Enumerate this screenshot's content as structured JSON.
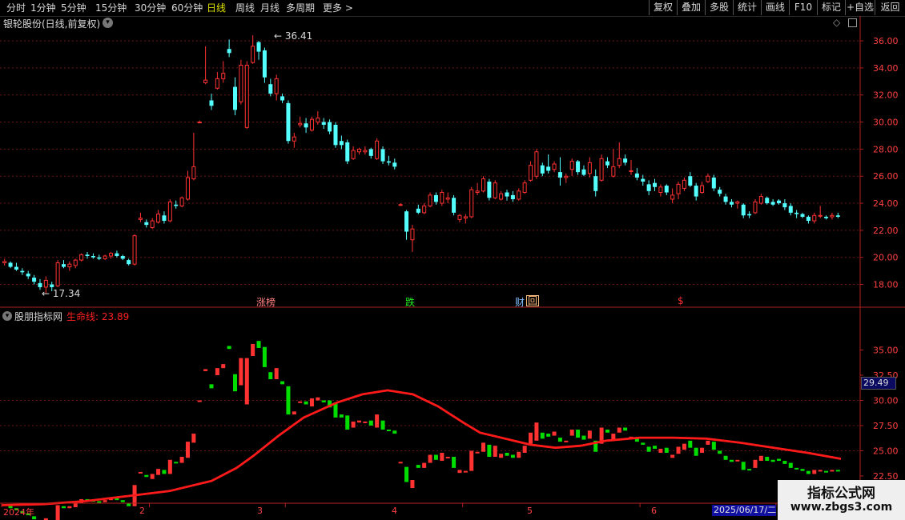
{
  "toolbar": {
    "periods": [
      {
        "label": "分时",
        "active": false
      },
      {
        "label": "1分钟",
        "active": false
      },
      {
        "label": "5分钟",
        "active": false
      },
      {
        "label": "15分钟",
        "active": false
      },
      {
        "label": "30分钟",
        "active": false
      },
      {
        "label": "60分钟",
        "active": false
      },
      {
        "label": "日线",
        "active": true
      },
      {
        "label": "周线",
        "active": false
      },
      {
        "label": "月线",
        "active": false
      },
      {
        "label": "多周期",
        "active": false
      },
      {
        "label": "更多 >",
        "active": false
      }
    ],
    "actions": [
      "复权",
      "叠加",
      "多股",
      "统计",
      "画线",
      "F10",
      "标记",
      "+自选",
      "返回"
    ]
  },
  "main_panel": {
    "title": "银轮股份(日线,前复权)",
    "high_label": "36.41",
    "low_label": "17.34",
    "event_markers": [
      "涨榜",
      "跌",
      "财",
      "回",
      "$"
    ]
  },
  "indicator_panel": {
    "name": "股朋指标网",
    "line_label": "生命线: 23.89",
    "current_value_tag": "29.49"
  },
  "time_axis": {
    "labels": [
      "2024年",
      "2",
      "3",
      "4",
      "5",
      "6"
    ],
    "cursor_date": "2025/06/17/二"
  },
  "watermark": {
    "title": "指标公式网",
    "url": "www.zbgs3.com"
  },
  "colors": {
    "up": "#ff3232",
    "down": "#54ffff",
    "indicator_down": "#00dd00",
    "life_line": "#ff1a1a",
    "axis": "#b02020",
    "grid": "#6a1515"
  },
  "chart_data": [
    {
      "type": "candlestick",
      "title": "银轮股份(日线,前复权)",
      "y_axis_ticks": [
        18.0,
        20.0,
        22.0,
        24.0,
        26.0,
        28.0,
        30.0,
        32.0,
        34.0,
        36.0
      ],
      "ylim": [
        16.2,
        37.6
      ],
      "x_labels": [
        "2024年",
        "2",
        "3",
        "4",
        "5",
        "6"
      ],
      "annotations": {
        "high": 36.41,
        "low": 17.34
      },
      "ohlc": [
        [
          19.6,
          19.9,
          19.4,
          19.7
        ],
        [
          19.6,
          19.7,
          19.2,
          19.3
        ],
        [
          19.3,
          19.6,
          19.0,
          19.1
        ],
        [
          19.0,
          19.2,
          18.7,
          18.9
        ],
        [
          18.8,
          19.0,
          18.4,
          18.6
        ],
        [
          18.5,
          18.7,
          18.0,
          18.2
        ],
        [
          18.1,
          18.4,
          17.6,
          17.8
        ],
        [
          17.8,
          18.6,
          17.34,
          18.3
        ],
        [
          18.0,
          18.2,
          17.5,
          17.8
        ],
        [
          17.9,
          19.8,
          17.8,
          19.6
        ],
        [
          19.5,
          19.8,
          19.2,
          19.3
        ],
        [
          19.3,
          19.7,
          19.0,
          19.5
        ],
        [
          19.4,
          19.9,
          19.2,
          19.8
        ],
        [
          19.8,
          20.3,
          19.7,
          20.2
        ],
        [
          20.2,
          20.4,
          19.9,
          20.1
        ],
        [
          20.1,
          20.3,
          19.9,
          20.0
        ],
        [
          20.0,
          20.2,
          19.8,
          19.9
        ],
        [
          19.9,
          20.2,
          19.8,
          20.1
        ],
        [
          20.1,
          20.4,
          19.9,
          20.3
        ],
        [
          20.3,
          20.5,
          20.0,
          20.1
        ],
        [
          20.1,
          20.2,
          19.8,
          19.9
        ],
        [
          19.8,
          19.9,
          19.4,
          19.5
        ],
        [
          19.5,
          21.7,
          19.4,
          21.6
        ],
        [
          22.8,
          23.3,
          22.6,
          22.9
        ],
        [
          22.6,
          22.8,
          22.2,
          22.4
        ],
        [
          22.2,
          22.9,
          22.1,
          22.7
        ],
        [
          22.6,
          23.5,
          22.5,
          23.2
        ],
        [
          23.1,
          23.4,
          22.5,
          22.7
        ],
        [
          22.7,
          24.3,
          22.6,
          24.1
        ],
        [
          23.9,
          24.2,
          23.6,
          23.8
        ],
        [
          23.8,
          24.5,
          23.7,
          24.4
        ],
        [
          24.3,
          26.4,
          24.2,
          25.9
        ],
        [
          25.8,
          29.2,
          25.7,
          26.7
        ],
        [
          30.0,
          30.1,
          29.9,
          30.0
        ],
        [
          32.9,
          35.6,
          32.8,
          33.1
        ],
        [
          31.6,
          32.1,
          30.9,
          31.2
        ],
        [
          32.5,
          33.7,
          32.4,
          33.2
        ],
        [
          33.2,
          34.5,
          32.9,
          33.6
        ],
        [
          35.4,
          36.1,
          34.8,
          35.1
        ],
        [
          32.6,
          33.3,
          30.5,
          30.9
        ],
        [
          31.5,
          34.6,
          31.3,
          34.2
        ],
        [
          29.6,
          34.5,
          29.5,
          34.2
        ],
        [
          34.4,
          36.41,
          34.3,
          35.6
        ],
        [
          35.9,
          36.0,
          34.6,
          35.2
        ],
        [
          35.3,
          35.5,
          32.9,
          33.3
        ],
        [
          32.8,
          33.2,
          31.9,
          32.1
        ],
        [
          32.1,
          33.5,
          31.6,
          33.2
        ],
        [
          31.9,
          32.1,
          31.4,
          31.6
        ],
        [
          31.4,
          31.6,
          28.4,
          28.6
        ],
        [
          28.6,
          29.2,
          28.1,
          28.9
        ],
        [
          29.8,
          30.4,
          29.6,
          29.9
        ],
        [
          29.9,
          30.3,
          29.2,
          29.6
        ],
        [
          29.4,
          30.4,
          29.3,
          30.2
        ],
        [
          30.0,
          30.8,
          29.8,
          30.3
        ],
        [
          30.0,
          30.3,
          29.5,
          29.8
        ],
        [
          30.0,
          30.2,
          29.1,
          29.3
        ],
        [
          29.8,
          30.0,
          28.1,
          28.3
        ],
        [
          28.6,
          29.0,
          28.0,
          28.3
        ],
        [
          28.5,
          28.7,
          26.9,
          27.1
        ],
        [
          27.3,
          28.2,
          27.2,
          27.9
        ],
        [
          27.8,
          28.1,
          27.6,
          28.0
        ],
        [
          27.8,
          28.2,
          27.6,
          27.9
        ],
        [
          28.0,
          28.1,
          27.3,
          27.5
        ],
        [
          27.3,
          28.8,
          27.2,
          28.6
        ],
        [
          28.0,
          28.2,
          26.9,
          27.1
        ],
        [
          27.1,
          27.5,
          26.8,
          27.0
        ],
        [
          27.0,
          27.3,
          26.5,
          26.7
        ],
        [
          23.9,
          24.0,
          23.8,
          23.9
        ],
        [
          23.4,
          23.5,
          21.3,
          21.9
        ],
        [
          21.3,
          22.4,
          20.4,
          22.1
        ],
        [
          23.6,
          23.9,
          23.2,
          23.3
        ],
        [
          23.3,
          24.0,
          23.2,
          23.8
        ],
        [
          23.8,
          24.8,
          23.7,
          24.6
        ],
        [
          24.6,
          24.8,
          23.9,
          24.1
        ],
        [
          24.0,
          25.0,
          23.8,
          24.8
        ],
        [
          24.3,
          24.8,
          24.0,
          24.4
        ],
        [
          24.4,
          24.6,
          23.1,
          23.3
        ],
        [
          22.8,
          23.2,
          22.6,
          23.1
        ],
        [
          22.9,
          23.2,
          22.5,
          23.0
        ],
        [
          23.0,
          25.2,
          22.9,
          25.0
        ],
        [
          24.8,
          25.5,
          24.6,
          24.9
        ],
        [
          24.9,
          26.0,
          24.8,
          25.8
        ],
        [
          25.6,
          25.8,
          24.2,
          24.4
        ],
        [
          24.4,
          25.7,
          24.3,
          25.5
        ],
        [
          24.3,
          24.9,
          24.2,
          24.7
        ],
        [
          24.8,
          25.0,
          24.2,
          24.5
        ],
        [
          24.6,
          24.9,
          24.1,
          24.3
        ],
        [
          24.3,
          25.1,
          24.2,
          24.9
        ],
        [
          24.8,
          25.7,
          24.7,
          25.5
        ],
        [
          25.7,
          27.1,
          25.6,
          26.8
        ],
        [
          26.0,
          28.0,
          25.8,
          27.8
        ],
        [
          26.8,
          27.0,
          26.0,
          26.2
        ],
        [
          26.7,
          27.6,
          26.2,
          26.4
        ],
        [
          26.5,
          27.1,
          26.3,
          26.9
        ],
        [
          26.3,
          27.4,
          25.3,
          25.9
        ],
        [
          25.9,
          26.2,
          25.5,
          26.0
        ],
        [
          26.5,
          27.3,
          26.0,
          27.1
        ],
        [
          27.1,
          27.2,
          26.1,
          26.3
        ],
        [
          26.5,
          26.8,
          26.0,
          26.1
        ],
        [
          26.2,
          27.4,
          25.9,
          27.0
        ],
        [
          26.0,
          26.5,
          24.5,
          24.9
        ],
        [
          25.7,
          27.6,
          25.6,
          27.3
        ],
        [
          27.1,
          27.4,
          26.6,
          26.8
        ],
        [
          26.0,
          28.0,
          25.9,
          26.7
        ],
        [
          26.8,
          28.5,
          26.6,
          27.3
        ],
        [
          27.3,
          27.6,
          26.8,
          27.0
        ],
        [
          26.4,
          27.2,
          26.1,
          26.4
        ],
        [
          26.2,
          26.6,
          25.7,
          25.9
        ],
        [
          25.8,
          26.1,
          25.3,
          25.6
        ],
        [
          25.4,
          25.7,
          24.6,
          24.9
        ],
        [
          25.5,
          25.8,
          24.9,
          25.2
        ],
        [
          24.8,
          25.4,
          24.5,
          25.2
        ],
        [
          25.3,
          25.4,
          24.6,
          24.8
        ],
        [
          24.3,
          25.1,
          24.0,
          24.6
        ],
        [
          24.7,
          25.6,
          24.3,
          25.4
        ],
        [
          25.1,
          25.9,
          24.9,
          25.7
        ],
        [
          26.0,
          26.3,
          25.2,
          25.3
        ],
        [
          25.3,
          25.5,
          24.2,
          24.5
        ],
        [
          24.8,
          25.6,
          24.7,
          25.3
        ],
        [
          25.6,
          26.2,
          25.5,
          26.0
        ],
        [
          25.9,
          26.1,
          24.9,
          25.1
        ],
        [
          25.0,
          25.2,
          24.5,
          24.7
        ],
        [
          24.5,
          24.7,
          23.9,
          24.1
        ],
        [
          24.1,
          24.3,
          23.7,
          23.9
        ],
        [
          24.0,
          24.2,
          23.6,
          24.1
        ],
        [
          23.9,
          24.0,
          22.9,
          23.1
        ],
        [
          23.2,
          23.4,
          22.9,
          23.1
        ],
        [
          23.3,
          24.3,
          23.2,
          24.1
        ],
        [
          24.0,
          24.7,
          23.9,
          24.5
        ],
        [
          24.4,
          24.5,
          23.9,
          24.0
        ],
        [
          24.1,
          24.3,
          23.8,
          23.9
        ],
        [
          24.2,
          24.3,
          23.9,
          24.0
        ],
        [
          24.0,
          24.3,
          23.5,
          23.7
        ],
        [
          23.8,
          24.0,
          23.1,
          23.3
        ],
        [
          23.3,
          23.5,
          22.9,
          23.2
        ],
        [
          23.2,
          23.3,
          22.9,
          23.0
        ],
        [
          23.0,
          23.1,
          22.5,
          22.7
        ],
        [
          22.7,
          23.3,
          22.5,
          23.1
        ],
        [
          23.1,
          23.8,
          22.9,
          23.1
        ],
        [
          23.0,
          23.1,
          22.8,
          22.9
        ],
        [
          23.0,
          23.3,
          22.8,
          23.1
        ],
        [
          23.1,
          23.3,
          22.9,
          23.0
        ]
      ]
    },
    {
      "type": "line",
      "title": "股朋指标网",
      "series_name": "生命线",
      "latest_value": 23.89,
      "y_axis_ticks": [
        20.0,
        22.5,
        25.0,
        27.5,
        30.0,
        32.5,
        35.0
      ],
      "ylim": [
        19.4,
        37.5
      ],
      "life_line_x_fraction": [
        0.0,
        0.05,
        0.1,
        0.15,
        0.2,
        0.25,
        0.28,
        0.3,
        0.33,
        0.36,
        0.4,
        0.43,
        0.46,
        0.49,
        0.52,
        0.55,
        0.57,
        0.6,
        0.63,
        0.66,
        0.69,
        0.72,
        0.76,
        0.8,
        0.84,
        0.88,
        0.92,
        0.96,
        1.0
      ],
      "life_line_values": [
        19.6,
        19.7,
        20.0,
        20.5,
        21.0,
        22.0,
        23.3,
        24.5,
        26.5,
        28.3,
        29.8,
        30.6,
        31.0,
        30.6,
        29.4,
        27.8,
        26.8,
        26.2,
        25.6,
        25.3,
        25.5,
        26.0,
        26.3,
        26.3,
        26.2,
        25.8,
        25.3,
        24.8,
        24.2
      ]
    }
  ]
}
